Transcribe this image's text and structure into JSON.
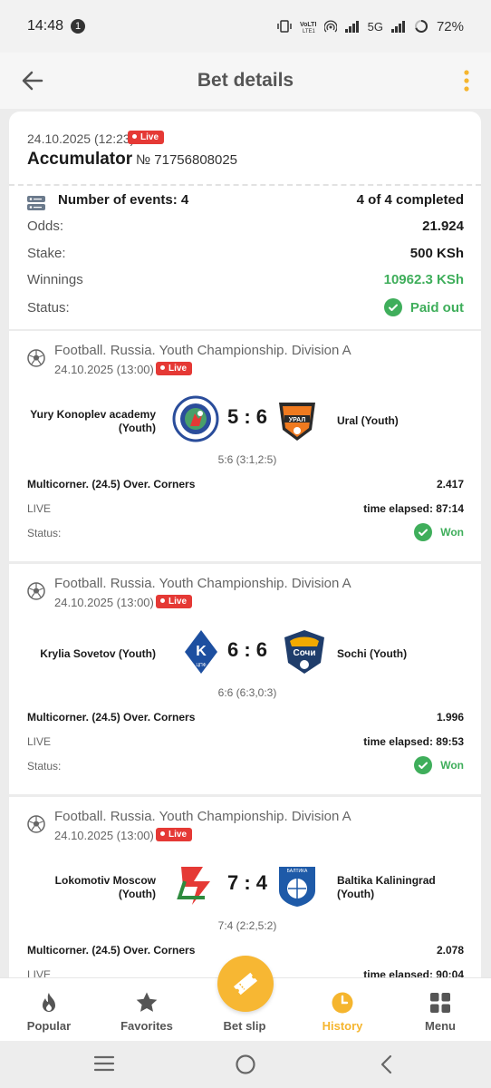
{
  "status_bar": {
    "time": "14:48",
    "notif_count": "1",
    "network": "5G",
    "battery": "72%"
  },
  "header": {
    "title": "Bet details"
  },
  "bet": {
    "datetime": "24.10.2025 (12:23)",
    "live_label": "Live",
    "type": "Accumulator",
    "number": "№ 71756808025",
    "events_label": "Number of events: 4",
    "completed": "4 of 4 completed",
    "rows": [
      {
        "label": "Odds:",
        "value": "21.924"
      },
      {
        "label": "Stake:",
        "value": "500 KSh"
      },
      {
        "label": "Winnings",
        "value": "10962.3 KSh"
      },
      {
        "label": "Status:",
        "value": "Paid out"
      }
    ]
  },
  "events": [
    {
      "league": "Football. Russia. Youth Championship. Division A",
      "date": "24.10.2025 (13:00)",
      "live_label": "Live",
      "home": "Yury Konoplev academy (Youth)",
      "away": "Ural (Youth)",
      "score": "5 : 6",
      "subscore": "5:6 (3:1,2:5)",
      "bet": "Multicorner. (24.5) Over. Corners",
      "coef": "2.417",
      "live_text": "LIVE",
      "elapsed": "time elapsed: 87:14",
      "status_label": "Status:",
      "status": "Won"
    },
    {
      "league": "Football. Russia. Youth Championship. Division A",
      "date": "24.10.2025 (13:00)",
      "live_label": "Live",
      "home": "Krylia Sovetov (Youth)",
      "away": "Sochi (Youth)",
      "score": "6 : 6",
      "subscore": "6:6 (6:3,0:3)",
      "bet": "Multicorner. (24.5) Over. Corners",
      "coef": "1.996",
      "live_text": "LIVE",
      "elapsed": "time elapsed: 89:53",
      "status_label": "Status:",
      "status": "Won"
    },
    {
      "league": "Football. Russia. Youth Championship. Division A",
      "date": "24.10.2025 (13:00)",
      "live_label": "Live",
      "home": "Lokomotiv Moscow (Youth)",
      "away": "Baltika Kaliningrad (Youth)",
      "score": "7 : 4",
      "subscore": "7:4 (2:2,5:2)",
      "bet": "Multicorner. (24.5) Over. Corners",
      "coef": "2.078",
      "live_text": "LIVE",
      "elapsed": "time elapsed: 90:04"
    }
  ],
  "nav": [
    {
      "label": "Popular",
      "icon": "flame-icon"
    },
    {
      "label": "Favorites",
      "icon": "star-icon"
    },
    {
      "label": "Bet slip",
      "icon": "ticket-icon"
    },
    {
      "label": "History",
      "icon": "clock-icon"
    },
    {
      "label": "Menu",
      "icon": "grid-icon"
    }
  ],
  "colors": {
    "accent": "#f5b52e",
    "live": "#e53935",
    "success": "#3fae5b"
  }
}
